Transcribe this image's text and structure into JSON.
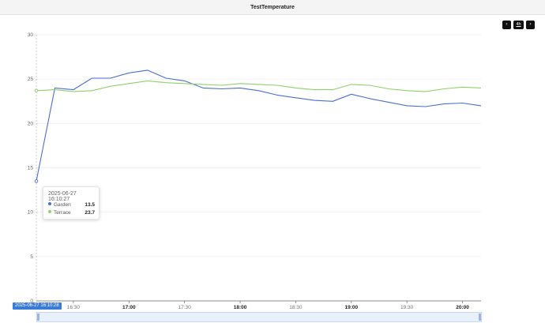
{
  "header": {
    "title": "TestTemperature"
  },
  "nav": {
    "prev": "‹",
    "range": "4h",
    "next": "›"
  },
  "chart_data": {
    "type": "line",
    "title": "TestTemperature",
    "xlabel": "",
    "ylabel": "",
    "x_range": [
      "2025-06-27 16:10",
      "2025-06-27 20:10"
    ],
    "ylim": [
      0,
      30
    ],
    "y_ticks": [
      "0",
      "5",
      "10",
      "15",
      "20",
      "25",
      "30"
    ],
    "x_ticks": [
      {
        "t": "16:30",
        "label": "16:30",
        "bold": false
      },
      {
        "t": "17:00",
        "label": "17:00",
        "bold": true
      },
      {
        "t": "17:30",
        "label": "17:30",
        "bold": false
      },
      {
        "t": "18:00",
        "label": "18:00",
        "bold": true
      },
      {
        "t": "18:30",
        "label": "18:30",
        "bold": false
      },
      {
        "t": "19:00",
        "label": "19:00",
        "bold": true
      },
      {
        "t": "19:30",
        "label": "19:30",
        "bold": false
      },
      {
        "t": "20:00",
        "label": "20:00",
        "bold": true
      }
    ],
    "grid": true,
    "series": [
      {
        "name": "Garden",
        "color": "#4a6fd1",
        "points": [
          [
            "16:10",
            13.5
          ],
          [
            "16:20",
            24.0
          ],
          [
            "16:30",
            23.8
          ],
          [
            "16:40",
            25.1
          ],
          [
            "16:50",
            25.1
          ],
          [
            "17:00",
            25.7
          ],
          [
            "17:10",
            26.0
          ],
          [
            "17:20",
            25.1
          ],
          [
            "17:30",
            24.8
          ],
          [
            "17:40",
            24.0
          ],
          [
            "17:50",
            23.9
          ],
          [
            "18:00",
            24.0
          ],
          [
            "18:10",
            23.7
          ],
          [
            "18:20",
            23.2
          ],
          [
            "18:30",
            22.9
          ],
          [
            "18:40",
            22.6
          ],
          [
            "18:50",
            22.5
          ],
          [
            "19:00",
            23.3
          ],
          [
            "19:10",
            22.8
          ],
          [
            "19:20",
            22.4
          ],
          [
            "19:30",
            22.0
          ],
          [
            "19:40",
            21.9
          ],
          [
            "19:50",
            22.2
          ],
          [
            "20:00",
            22.3
          ],
          [
            "20:10",
            22.0
          ]
        ]
      },
      {
        "name": "Terrace",
        "color": "#8fd16b",
        "points": [
          [
            "16:10",
            23.7
          ],
          [
            "16:20",
            23.8
          ],
          [
            "16:30",
            23.6
          ],
          [
            "16:40",
            23.7
          ],
          [
            "16:50",
            24.2
          ],
          [
            "17:00",
            24.5
          ],
          [
            "17:10",
            24.8
          ],
          [
            "17:20",
            24.6
          ],
          [
            "17:30",
            24.5
          ],
          [
            "17:40",
            24.4
          ],
          [
            "17:50",
            24.3
          ],
          [
            "18:00",
            24.5
          ],
          [
            "18:10",
            24.4
          ],
          [
            "18:20",
            24.3
          ],
          [
            "18:30",
            24.0
          ],
          [
            "18:40",
            23.8
          ],
          [
            "18:50",
            23.8
          ],
          [
            "19:00",
            24.4
          ],
          [
            "19:10",
            24.3
          ],
          [
            "19:20",
            23.9
          ],
          [
            "19:30",
            23.7
          ],
          [
            "19:40",
            23.6
          ],
          [
            "19:50",
            23.9
          ],
          [
            "20:00",
            24.1
          ],
          [
            "20:10",
            24.0
          ]
        ]
      }
    ],
    "tooltip": {
      "time": "2025-06-27 16:10:27",
      "rows": [
        {
          "name": "Garden",
          "value": "13.5",
          "color": "#4a6fd1"
        },
        {
          "name": "Terrace",
          "value": "23.7",
          "color": "#8fd16b"
        }
      ]
    },
    "cursor_label": "2025-06-27 16:10:28"
  }
}
